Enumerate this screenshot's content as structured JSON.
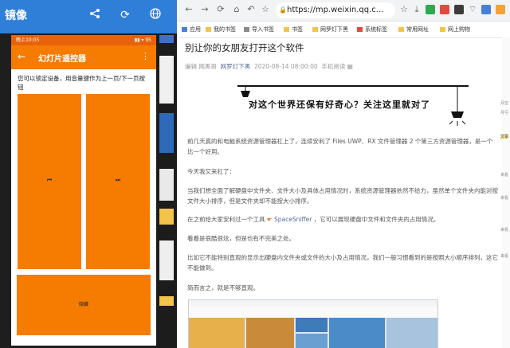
{
  "mirror": {
    "title": "镜像"
  },
  "phone": {
    "status_time": "晚上10:05",
    "status_right": "▮▮ ▾ 95",
    "app_title": "幻灯片遥控器",
    "description": "您可以锁定设备，用音量键作为上一页/下一页按钮",
    "prev_symbol": "⏮",
    "next_symbol": "⏭",
    "hide_label": "隐藏"
  },
  "browser": {
    "url": "https://mp.weixin.qq.c...",
    "bookmarks": [
      {
        "label": "应用"
      },
      {
        "label": "我的书签"
      },
      {
        "label": "导入书签"
      },
      {
        "label": "书签"
      },
      {
        "label": "网罗灯下黑"
      },
      {
        "label": "系统标签"
      },
      {
        "label": "常用网址"
      },
      {
        "label": "网上购物"
      }
    ]
  },
  "article": {
    "title": "别让你的女朋友打开这个软件",
    "meta_author": "编辑  网黑哥",
    "meta_account": "网罗灯下黑",
    "meta_date": "2020-08-14 08:00:00",
    "meta_read": "手机阅读",
    "banner_text": "对这个世界还保有好奇心？关注这里就对了",
    "p1": "前几天真的和电脑系统资源管理器杠上了，连续安利了 Files UWP、RX 文件管理器 2 个第三方资源管理器，是一个比一个好用。",
    "p2": "今天我又来杠了：",
    "p3": "当我们想全面了解硬盘中文件夹、文件大小及具体占用情况时，系统资源管理器依然不给力，虽然单个文件夹内能对按文件大小排序，但是文件夹却不能按大小排序。",
    "p4a": "在之前给大家安利过一个工具",
    "p4_link": "SpaceSniffer",
    "p4b": "，它可以展现硬盘中文件和文件夹的占用情况。",
    "p5": "看看是很酷很炫，但是也有不完美之处。",
    "p6": "比如它不能特别直观的显示出硬盘内文件夹或文件的大小及占用情况，我们一般习惯看到的是按照大小顺序排列，这它不能做到。",
    "p7": "简而言之，就是不够直观。"
  },
  "side": {
    "items": [
      "月空",
      "月亏",
      "文章",
      "来看",
      "来看",
      "来看",
      "来看"
    ]
  },
  "colors": {
    "accent_orange": "#f57c00",
    "status_orange": "#e8620c",
    "mirror_blue": "#2f7ed8",
    "link_blue": "#576b95"
  }
}
